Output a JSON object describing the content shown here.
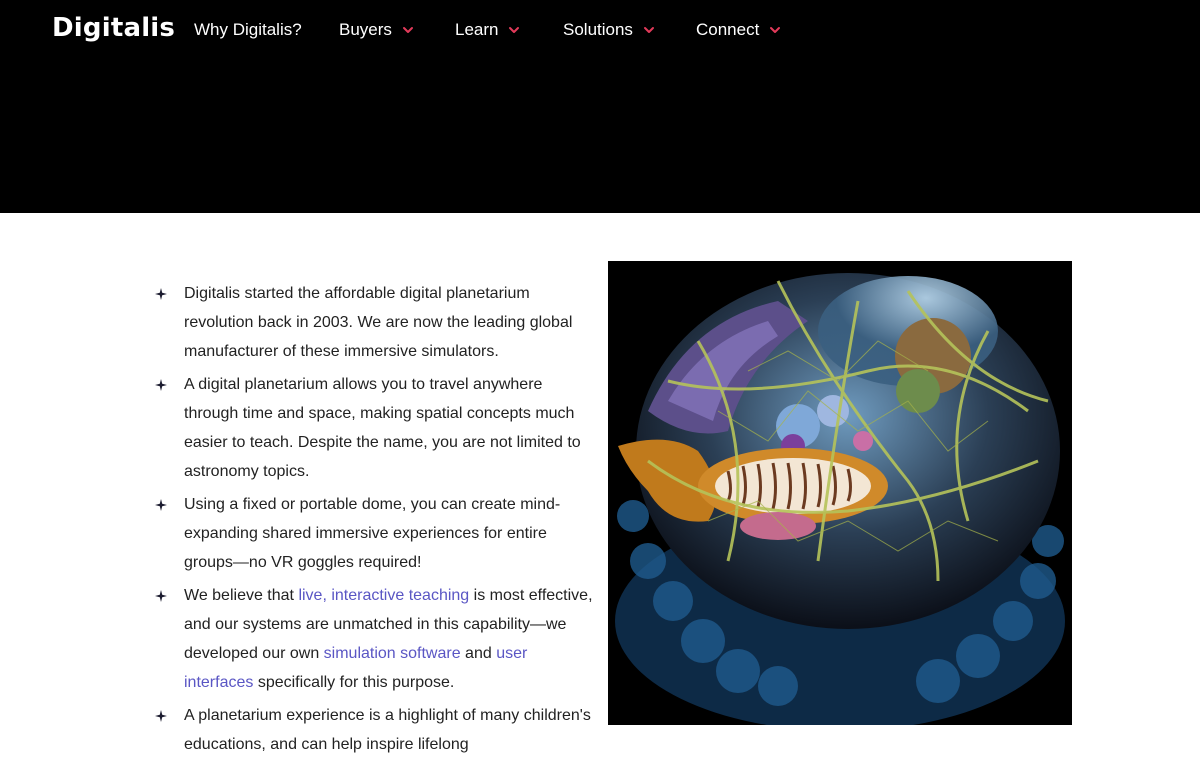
{
  "header": {
    "logo": "Digitalis",
    "nav": [
      {
        "label": "Why Digitalis?",
        "dropdown": false
      },
      {
        "label": "Buyers",
        "dropdown": true
      },
      {
        "label": "Learn",
        "dropdown": true
      },
      {
        "label": "Solutions",
        "dropdown": true
      },
      {
        "label": "Connect",
        "dropdown": true
      }
    ]
  },
  "colors": {
    "header_bg": "#000000",
    "chevron": "#e23a5a",
    "link": "#5a56c4",
    "text": "#222222"
  },
  "icons": {
    "bullet": "four-point-star-icon",
    "dropdown": "chevron-down-icon"
  },
  "bullets": [
    {
      "text": "Digitalis started the affordable digital planetarium revolution back in 2003. We are now the leading global manufacturer of these immersive simulators."
    },
    {
      "text": "A digital planetarium allows you to travel anywhere through time and space, making spatial concepts much easier to teach. Despite the name, you are not limited to astronomy topics."
    },
    {
      "text": "Using a fixed or portable dome, you can create mind-expanding shared immersive experiences for entire groups—no VR goggles required!"
    },
    {
      "t1": "We believe that ",
      "link1": "live, interactive teaching",
      "t2": " is most effective, and our systems are unmatched in this capability—we developed our own ",
      "link2": "simulation software",
      "t3": " and ",
      "link3": "user interfaces",
      "t4": " specifically for this purpose."
    },
    {
      "text": "A planetarium experience is a highlight of many children's educations, and can help inspire lifelong"
    }
  ]
}
